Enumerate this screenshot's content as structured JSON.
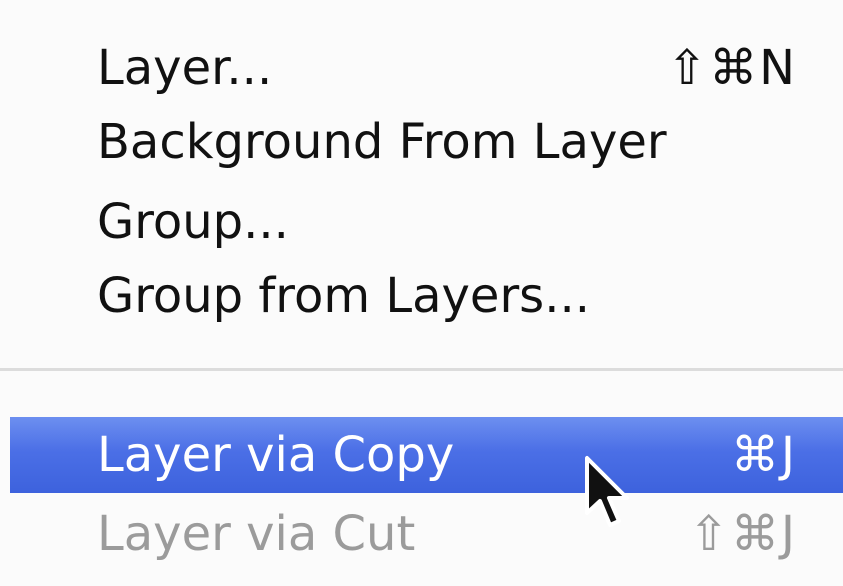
{
  "menu": {
    "items": [
      {
        "label": "Layer...",
        "shortcut": "⇧⌘N",
        "enabled": true,
        "highlighted": false
      },
      {
        "label": "Background From Layer",
        "shortcut": "",
        "enabled": true,
        "highlighted": false
      },
      {
        "label": "Group...",
        "shortcut": "",
        "enabled": true,
        "highlighted": false
      },
      {
        "label": "Group from Layers...",
        "shortcut": "",
        "enabled": true,
        "highlighted": false
      },
      {
        "label": "Layer via Copy",
        "shortcut": "⌘J",
        "enabled": true,
        "highlighted": true
      },
      {
        "label": "Layer via Cut",
        "shortcut": "⇧⌘J",
        "enabled": false,
        "highlighted": false
      }
    ]
  },
  "colors": {
    "highlight": "#4b6fe6",
    "text": "#111111",
    "disabled_text": "#9b9b9b",
    "separator": "#dcdcdc",
    "background": "#fbfbfb"
  },
  "cursor": {
    "icon": "arrow-pointer-icon"
  }
}
